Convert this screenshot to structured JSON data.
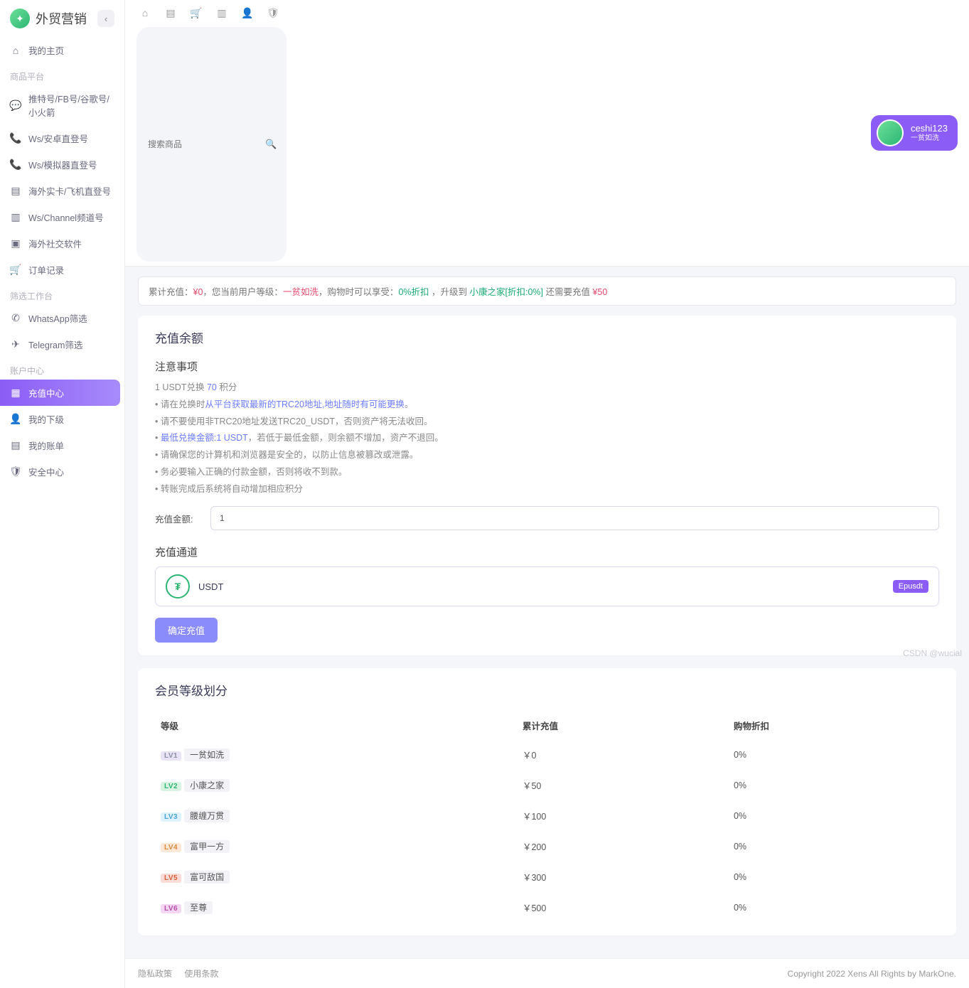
{
  "brand": "外贸营销",
  "sidebar": {
    "home": "我的主页",
    "sec1_title": "商品平台",
    "sec1": [
      "推特号/FB号/谷歌号/小火箭",
      "Ws/安卓直登号",
      "Ws/模拟器直登号",
      "海外实卡/飞机直登号",
      "Ws/Channel频道号",
      "海外社交软件",
      "订单记录"
    ],
    "sec2_title": "筛选工作台",
    "sec2": [
      "WhatsApp筛选",
      "Telegram筛选"
    ],
    "sec3_title": "账户中心",
    "sec3": [
      "充值中心",
      "我的下级",
      "我的账单",
      "安全中心"
    ]
  },
  "search_placeholder": "搜索商品",
  "user": {
    "name": "ceshi123",
    "level": "一贫如洗"
  },
  "alert": {
    "t1": "累计充值：",
    "v1": "¥0",
    "t2": "，您当前用户等级：",
    "v2": "一贫如洗",
    "t3": "，购物时可以享受：",
    "v3": "0%折扣",
    "t4": " ，升级到 ",
    "v4": "小康之家[折扣:0%]",
    "t5": " 还需要充值 ",
    "v5": "¥50"
  },
  "recharge": {
    "title": "充值余额",
    "notice_title": "注意事项",
    "line1a": "1 USDT兑换 ",
    "line1b": "70 ",
    "line1c": "积分",
    "line2a": "• 请在兑换时",
    "line2b": "从平台获取最新的TRC20地址,地址随时有可能更换",
    "line2c": "。",
    "line3": "• 请不要使用非TRC20地址发送TRC20_USDT，否则资产将无法收回。",
    "line4a": "• ",
    "line4b": "最低兑换金额:1 USDT",
    "line4c": "，若低于最低金额，则余额不增加，资产不退回。",
    "line5": "• 请确保您的计算机和浏览器是安全的，以防止信息被篡改或泄露。",
    "line6": "• 务必要输入正确的付款金额，否则将收不到款。",
    "line7": "• 转账完成后系统将自动增加相应积分",
    "amount_label": "充值金额:",
    "amount_value": "1",
    "channel_title": "充值通道",
    "channel_name": "USDT",
    "channel_tag": "Epusdt",
    "confirm": "确定充值"
  },
  "levels": {
    "title": "会员等级划分",
    "headers": [
      "等级",
      "累计充值",
      "购物折扣"
    ],
    "rows": [
      {
        "lv": "LV1",
        "cls": "lv1",
        "name": "一贫如洗",
        "amt": "￥0",
        "disc": "0%"
      },
      {
        "lv": "LV2",
        "cls": "lv2",
        "name": "小康之家",
        "amt": "￥50",
        "disc": "0%"
      },
      {
        "lv": "LV3",
        "cls": "lv3",
        "name": "腰缠万贯",
        "amt": "￥100",
        "disc": "0%"
      },
      {
        "lv": "LV4",
        "cls": "lv4",
        "name": "富甲一方",
        "amt": "￥200",
        "disc": "0%"
      },
      {
        "lv": "LV5",
        "cls": "lv5",
        "name": "富可敌国",
        "amt": "￥300",
        "disc": "0%"
      },
      {
        "lv": "LV6",
        "cls": "lv6",
        "name": "至尊",
        "amt": "￥500",
        "disc": "0%"
      }
    ]
  },
  "footer": {
    "privacy": "隐私政策",
    "terms": "使用条款",
    "copyright": "Copyright 2022 Xens All Rights by MarkOne."
  },
  "watermark": "CSDN @wucial"
}
